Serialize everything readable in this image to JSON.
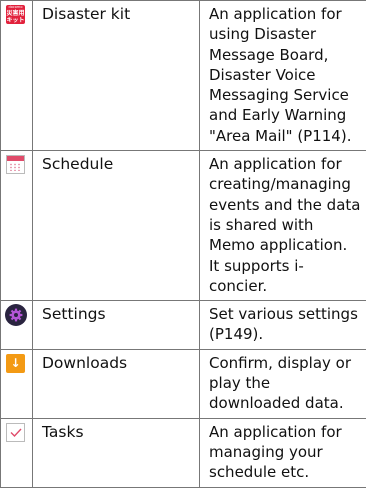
{
  "rows": [
    {
      "icon": "disaster-kit-icon",
      "icon_text": {
        "brand": "docomo",
        "kanji": "災害用キット"
      },
      "name": "Disaster kit",
      "description": "An application for using Disaster Message Board, Disaster Voice Messaging Service and Early Warning \"Area Mail\" (P114)."
    },
    {
      "icon": "calendar-icon",
      "name": "Schedule",
      "description": "An application for creating/managing events and the data is shared with Memo application. It supports i-concier."
    },
    {
      "icon": "gear-icon",
      "name": "Settings",
      "description": "Set various settings (P149)."
    },
    {
      "icon": "download-icon",
      "icon_glyph": "↓",
      "name": "Downloads",
      "description": "Confirm, display or play the downloaded data."
    },
    {
      "icon": "checkbox-icon",
      "name": "Tasks",
      "description": "An application for managing your schedule etc."
    }
  ]
}
